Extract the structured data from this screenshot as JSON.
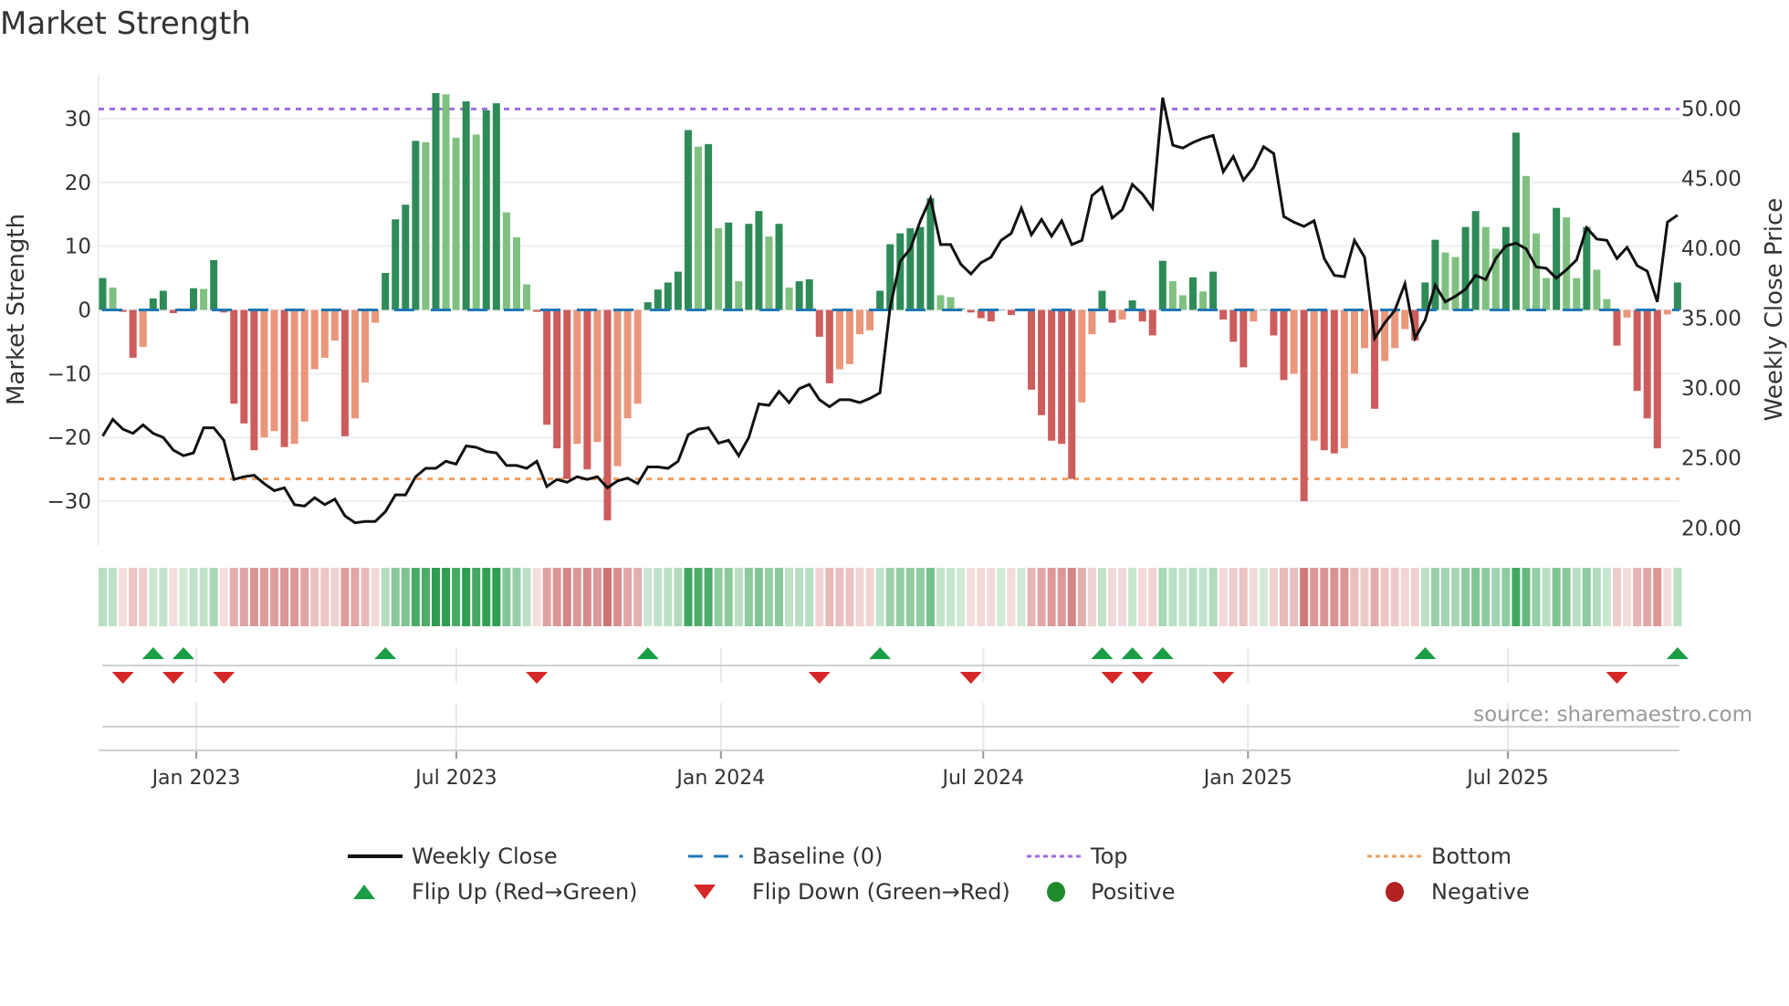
{
  "title": "Market Strength",
  "source": "source: sharemaestro.com",
  "colors": {
    "green_dark": "#2e8b57",
    "green_light": "#80c080",
    "red_dark": "#cd5c5c",
    "red_light": "#e9967a",
    "top": "#a06be0",
    "bottom": "#f0a060",
    "baseline": "#1f77b4",
    "flip_up": "#1a9e45",
    "flip_down": "#d62728",
    "line": "#111111"
  },
  "legend": [
    {
      "key": "weekly_close",
      "label": "Weekly Close"
    },
    {
      "key": "baseline",
      "label": "Baseline (0)"
    },
    {
      "key": "top",
      "label": "Top"
    },
    {
      "key": "bottom",
      "label": "Bottom"
    },
    {
      "key": "flip_up",
      "label": "Flip Up (Red→Green)"
    },
    {
      "key": "flip_down",
      "label": "Flip Down (Green→Red)"
    },
    {
      "key": "positive",
      "label": "Positive"
    },
    {
      "key": "negative",
      "label": "Negative"
    }
  ],
  "chart_data": {
    "type": "bar",
    "title": "Market Strength",
    "ylabel": "Market Strength",
    "y2label": "Weekly Close Price",
    "ylim": [
      -37,
      37
    ],
    "y2lim": [
      18.65,
      52.4
    ],
    "yticks": [
      -30,
      -20,
      -10,
      0,
      10,
      20,
      30
    ],
    "yticklabels": [
      "−30",
      "−20",
      "−10",
      "0",
      "10",
      "20",
      "30"
    ],
    "y2ticks": [
      20,
      25,
      30,
      35,
      40,
      45,
      50
    ],
    "y2ticklabels": [
      "20.00",
      "25.00",
      "30.00",
      "35.00",
      "40.00",
      "45.00",
      "50.00"
    ],
    "top_level": 31.5,
    "bottom_level": -26.5,
    "baseline": 0,
    "xticks": [
      {
        "label": "Jan 2023",
        "week": 9.27
      },
      {
        "label": "Jul 2023",
        "week": 35.03
      },
      {
        "label": "Jan 2024",
        "week": 61.24
      },
      {
        "label": "Jul 2024",
        "week": 87.23
      },
      {
        "label": "Jan 2025",
        "week": 113.45
      },
      {
        "label": "Jul 2025",
        "week": 139.2
      }
    ],
    "strength": [
      5,
      3.5,
      -0.3,
      -7.5,
      -5.8,
      1.8,
      3,
      -0.5,
      0,
      3.4,
      3.3,
      7.8,
      -0.4,
      -14.7,
      -17.8,
      -22,
      -20,
      -19,
      -21.5,
      -21,
      -17.5,
      -9.3,
      -7.5,
      -4.8,
      -19.8,
      -17,
      -11.4,
      -2,
      5.8,
      14.2,
      16.5,
      26.5,
      26.3,
      34,
      33.8,
      27,
      32.7,
      27.5,
      31.3,
      32.4,
      15.3,
      11.4,
      4,
      -0.3,
      -18,
      -21.7,
      -26.5,
      -21,
      -25,
      -20.7,
      -33,
      -24.5,
      -17,
      -14.7,
      1.2,
      3.2,
      4.3,
      6,
      28.2,
      25.6,
      26,
      12.8,
      13.7,
      4.5,
      13.5,
      15.5,
      11.5,
      13.5,
      3.5,
      4.5,
      4.8,
      -4.2,
      -11.5,
      -9.3,
      -8.5,
      -3.8,
      -3.2,
      3,
      10.3,
      12,
      12.8,
      13,
      17.5,
      2.3,
      2,
      0.3,
      -0.4,
      -1.3,
      -1.8,
      0,
      -0.8,
      0,
      -12.5,
      -16.5,
      -20.5,
      -21,
      -26.5,
      -14.5,
      -3.8,
      3,
      -2,
      -1.5,
      1.5,
      -1.8,
      -4,
      7.7,
      4.5,
      2.3,
      5.1,
      2.9,
      6,
      -1.5,
      -5,
      -9,
      -1.8,
      0,
      -4,
      -11,
      -10,
      -30,
      -20.5,
      -22,
      -22.5,
      -21.7,
      -10,
      -6,
      -15.5,
      -8,
      -6,
      -3,
      -4.8,
      4.3,
      11,
      9,
      8.3,
      13,
      15.5,
      13,
      9.6,
      13,
      27.8,
      21,
      12,
      5,
      16,
      14.5,
      5,
      13,
      6.3,
      1.7,
      -5.6,
      -1.2,
      -12.7,
      -17,
      -21.7,
      -0.7,
      4.3
    ],
    "weekly_close": [
      26.5,
      27.7,
      27.0,
      26.7,
      27.3,
      26.7,
      26.4,
      25.5,
      25.1,
      25.3,
      27.1,
      27.1,
      26.2,
      23.4,
      23.6,
      23.7,
      23.1,
      22.6,
      22.8,
      21.6,
      21.5,
      22.1,
      21.6,
      22.0,
      20.8,
      20.3,
      20.4,
      20.4,
      21.1,
      22.3,
      22.3,
      23.6,
      24.2,
      24.2,
      24.7,
      24.5,
      25.8,
      25.7,
      25.4,
      25.3,
      24.4,
      24.4,
      24.2,
      24.7,
      22.9,
      23.4,
      23.2,
      23.6,
      23.4,
      23.6,
      22.8,
      23.3,
      23.5,
      23.1,
      24.3,
      24.3,
      24.2,
      24.7,
      26.6,
      27.0,
      27.1,
      26.0,
      26.2,
      25.1,
      26.4,
      28.8,
      28.7,
      29.7,
      28.9,
      29.9,
      30.2,
      29.1,
      28.6,
      29.1,
      29.1,
      28.9,
      29.2,
      29.6,
      35.7,
      39.0,
      39.9,
      41.9,
      43.5,
      40.2,
      40.2,
      38.8,
      38.1,
      38.9,
      39.3,
      40.5,
      41.0,
      42.8,
      40.9,
      42.0,
      40.8,
      41.9,
      40.2,
      40.5,
      43.7,
      44.3,
      42.1,
      42.7,
      44.5,
      43.8,
      42.8,
      50.7,
      47.3,
      47.1,
      47.5,
      47.8,
      48.0,
      45.4,
      46.5,
      44.8,
      45.7,
      47.2,
      46.7,
      42.2,
      41.8,
      41.5,
      41.9,
      39.2,
      38.0,
      37.9,
      40.5,
      39.3,
      33.5,
      34.6,
      35.5,
      37.4,
      33.5,
      34.8,
      37.3,
      36.1,
      36.5,
      37.0,
      38.0,
      37.7,
      39.2,
      40.1,
      40.3,
      39.9,
      38.6,
      38.5,
      37.8,
      38.4,
      39.1,
      41.4,
      40.6,
      40.5,
      39.2,
      40.0,
      38.7,
      38.3,
      36.1,
      41.8,
      42.3
    ],
    "flip_up_weeks": [
      5,
      8,
      28,
      54,
      77,
      99,
      102,
      105,
      131,
      156
    ],
    "flip_down_weeks": [
      2,
      7,
      12,
      43,
      71,
      86,
      100,
      103,
      111,
      150
    ],
    "legend_position": "bottom"
  }
}
